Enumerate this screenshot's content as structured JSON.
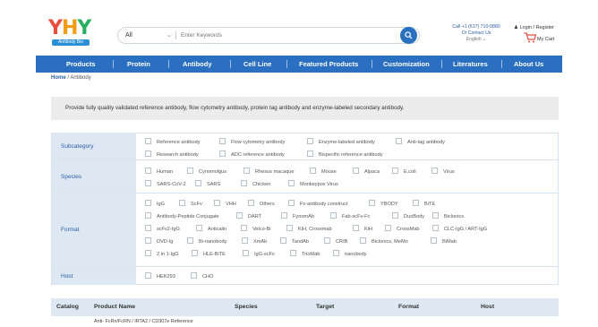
{
  "brand": {
    "name": "YHY",
    "tagline": "Antibody Bio"
  },
  "search": {
    "category": "All",
    "placeholder": "Enter Keywords"
  },
  "contact": {
    "phone": "Call +1 (617) 710-0880",
    "link": "Or Contact Us",
    "language": "English"
  },
  "account": {
    "login": "Login / Register",
    "cart": "My Cart"
  },
  "nav": [
    "Products",
    "Protein",
    "Antibody",
    "Cell Line",
    "Featured Products",
    "Customization",
    "Literatures",
    "About Us"
  ],
  "breadcrumb": {
    "home": "Home",
    "sep": "/",
    "current": "Antibody"
  },
  "intro": "Provide fully quality validated reference antibody, flow cytometry antibody, protein tag antibody and enzyme-labeled secondary antibody.",
  "filters": {
    "subcategory": {
      "label": "Subcategory",
      "options": [
        "Reference antibody",
        "Flow cytometry antibody",
        "Enzyme-labeled antibody",
        "Anti-tag antibody",
        "Research antibody",
        "ADC reference antibody",
        "Bispecific reference antibody"
      ]
    },
    "species": {
      "label": "Species",
      "options": [
        "Human",
        "Cynomolgus",
        "Rhesus macaque",
        "Mouse",
        "Alpaca",
        "E.coli",
        "Virus",
        "SARS-CoV-2",
        "SARS",
        "Chicken",
        "Monkeypox Virus"
      ]
    },
    "format": {
      "label": "Format",
      "options": [
        "IgG",
        "ScFv",
        "VHH",
        "Others",
        "Fv-antibody construct",
        "YBODY",
        "BiTE",
        "Antibody-Peptide Conjugate",
        "DART",
        "FynomAb",
        "Fab-scFv-Fc",
        "DuoBody",
        "Biclonics",
        "scFv2-IgG",
        "Anticalin",
        "Velco-Bi",
        "KiH, Crossmab",
        "KiH",
        "CrossMab",
        "CLC-IgG / ART-IgG",
        "DVD-Ig",
        "Bi-nanobody",
        "XmAb",
        "TandAb",
        "CRIB",
        "Biclonics, MeMo",
        "BiMab",
        "2 in 1-IgG",
        "HLE-BiTE",
        "IgG-scFv",
        "TriоMab",
        "nanobody"
      ]
    },
    "host": {
      "label": "Host",
      "options": [
        "HEK293",
        "CHO"
      ]
    }
  },
  "table": {
    "headers": [
      "Catalog",
      "Product Name",
      "Species",
      "Target",
      "Format",
      "Host"
    ],
    "first_row_name": "Anti- FcRn/FcRN / IRTA2 / CD307e Reference"
  },
  "colors": {
    "primary": "#2a6fc0",
    "label_bg": "#dde8f3",
    "intro_bg": "#ececec"
  }
}
